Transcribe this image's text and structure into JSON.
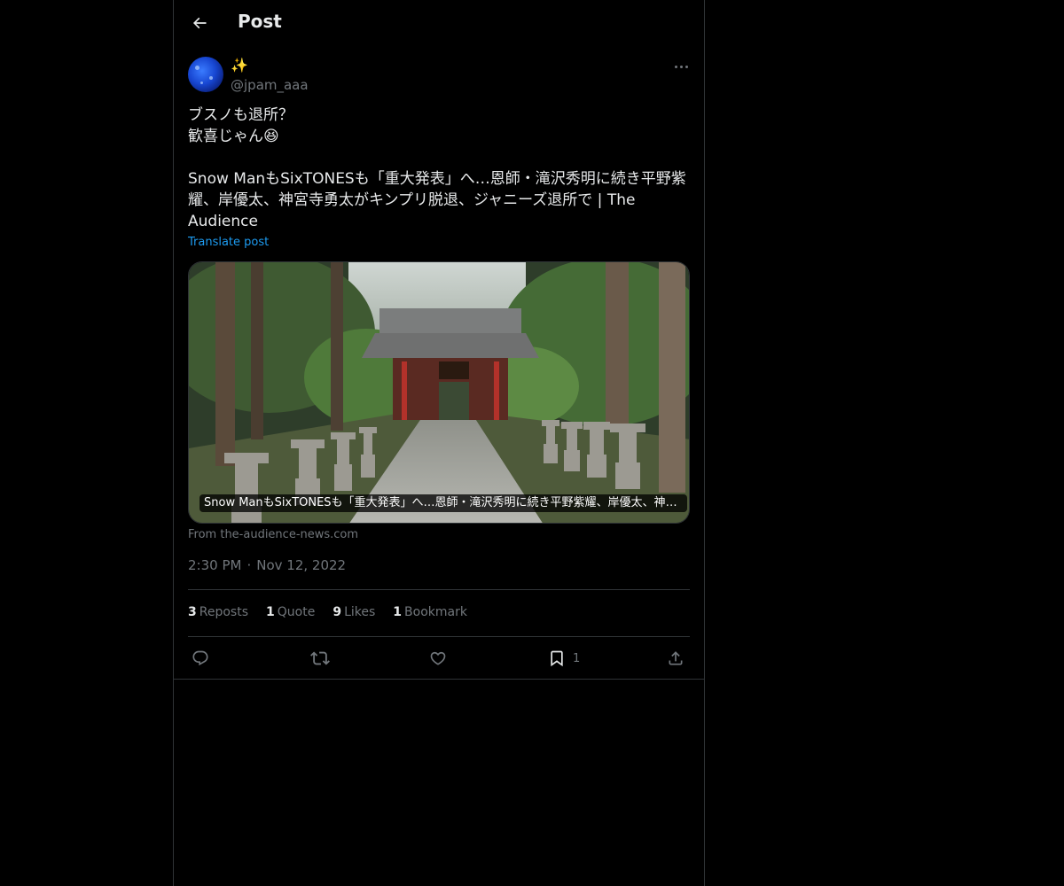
{
  "header": {
    "title": "Post"
  },
  "author": {
    "display_name": "✨",
    "handle": "@jpam_aaa"
  },
  "tweet": {
    "text": "ブスノも退所？\n歓喜じゃん😆\n\nSnow ManもSixTONESも「重大発表」へ…恩師・滝沢秀明に続き平野紫耀、岸優太、神宮寺勇太がキンプリ脱退、ジャニーズ退所で | The Audience",
    "translate_label": "Translate post"
  },
  "card": {
    "caption": "Snow ManもSixTONESも「重大発表」へ…恩師・滝沢秀明に続き平野紫耀、岸優太、神宮寺勇太がキンプリ脱退、ジャニーズ退所で | The Audience",
    "source": "From the-audience-news.com"
  },
  "meta": {
    "time": "2:30 PM",
    "separator": "·",
    "date": "Nov 12, 2022"
  },
  "stats": {
    "reposts_count": "3",
    "reposts_label": "Reposts",
    "quotes_count": "1",
    "quotes_label": "Quote",
    "likes_count": "9",
    "likes_label": "Likes",
    "bookmarks_count": "1",
    "bookmarks_label": "Bookmark"
  },
  "actions": {
    "bookmark_count": "1"
  },
  "icons": {
    "back": "arrow-left-icon",
    "more": "more-horizontal-icon",
    "reply": "reply-icon",
    "repost": "repost-icon",
    "like": "heart-icon",
    "bookmark": "bookmark-icon",
    "share": "share-icon"
  },
  "colors": {
    "background": "#000000",
    "text": "#e7e9ea",
    "secondary": "#71767b",
    "accent": "#1d9bf0",
    "border": "#2f3336"
  }
}
